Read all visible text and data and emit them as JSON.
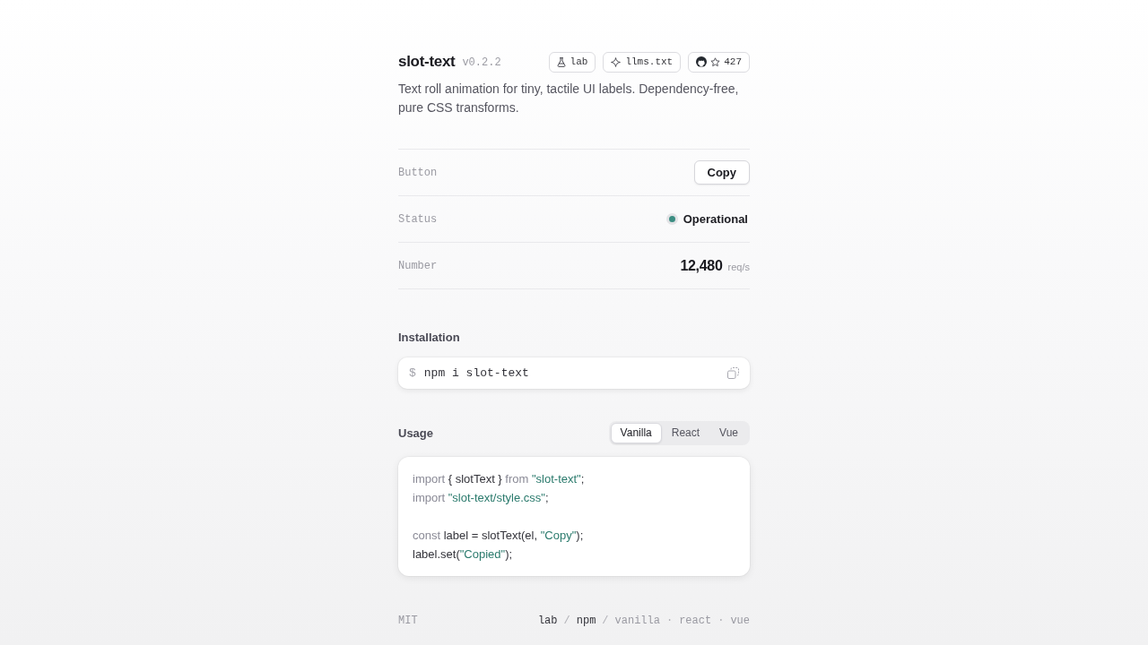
{
  "header": {
    "title": "slot-text",
    "version": "v0.2.2",
    "badges": [
      {
        "kind": "lab",
        "label": "lab"
      },
      {
        "kind": "docs",
        "label": "llms.txt"
      },
      {
        "kind": "repo",
        "label": "427"
      }
    ],
    "description": "Text roll animation for tiny, tactile UI labels. Dependency-free, pure CSS transforms."
  },
  "demo_rows": [
    {
      "kind": "button",
      "label": "Button",
      "value": "Copy"
    },
    {
      "kind": "status",
      "label": "Status",
      "value": "Operational",
      "color": "#3b8d82"
    },
    {
      "kind": "number",
      "label": "Number",
      "value": "12,480",
      "unit": "req/s"
    }
  ],
  "installation": {
    "heading": "Installation",
    "prompt": "$",
    "command": "npm i slot-text"
  },
  "usage": {
    "heading": "Usage",
    "tabs": [
      {
        "label": "Vanilla",
        "selected": true
      },
      {
        "label": "React",
        "selected": false
      },
      {
        "label": "Vue",
        "selected": false
      }
    ],
    "code_groups": [
      {
        "lines": [
          [
            {
              "kind": "keyword",
              "text": "import"
            },
            {
              "kind": "plain",
              "text": " { slotText } "
            },
            {
              "kind": "keyword",
              "text": "from "
            },
            {
              "kind": "string",
              "text": "\"slot-text\""
            },
            {
              "kind": "plain",
              "text": ";"
            }
          ],
          [
            {
              "kind": "keyword",
              "text": "import "
            },
            {
              "kind": "string",
              "text": "\"slot-text/style.css\""
            },
            {
              "kind": "plain",
              "text": ";"
            }
          ]
        ]
      },
      {
        "lines": [
          [
            {
              "kind": "keyword",
              "text": "const"
            },
            {
              "kind": "plain",
              "text": " label = slotText(el, "
            },
            {
              "kind": "string",
              "text": "\"Copy\""
            },
            {
              "kind": "plain",
              "text": ");"
            }
          ],
          [
            {
              "kind": "plain",
              "text": "label.set("
            },
            {
              "kind": "string",
              "text": "\"Copied\""
            },
            {
              "kind": "plain",
              "text": ");"
            }
          ]
        ]
      }
    ]
  },
  "footer": {
    "license": "MIT",
    "links": [
      {
        "kind": "primary",
        "text": "lab"
      },
      {
        "kind": "separator",
        "text": "/"
      },
      {
        "kind": "primary",
        "text": "npm"
      },
      {
        "kind": "separator",
        "text": "/"
      },
      {
        "kind": "secondary",
        "text": "vanilla"
      },
      {
        "kind": "separator",
        "text": "·"
      },
      {
        "kind": "secondary",
        "text": "react"
      },
      {
        "kind": "separator",
        "text": "·"
      },
      {
        "kind": "secondary",
        "text": "vue"
      }
    ]
  }
}
